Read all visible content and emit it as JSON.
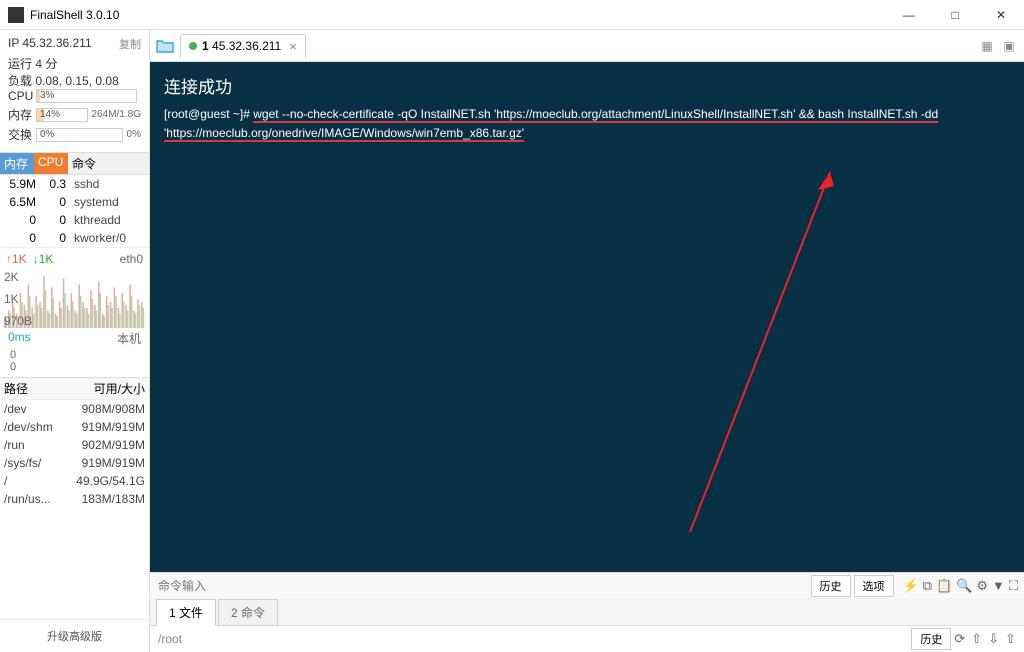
{
  "app": {
    "title": "FinalShell 3.0.10"
  },
  "win": {
    "min": "—",
    "max": "□",
    "close": "✕"
  },
  "sidebar": {
    "ip": "IP 45.32.36.211",
    "copy": "复制",
    "uptime": "运行 4 分",
    "load": "负载 0.08, 0.15, 0.08",
    "cpu": {
      "label": "CPU",
      "pct": "3%",
      "fill": 3
    },
    "mem": {
      "label": "内存",
      "pct": "14%",
      "extra": "264M/1.8G",
      "fill": 14
    },
    "swap": {
      "label": "交换",
      "pct": "0%",
      "extra": "0%",
      "fill": 0
    },
    "proc_hdr": {
      "c1": "内存",
      "c2": "CPU",
      "c3": "命令"
    },
    "procs": [
      {
        "mem": "5.9M",
        "cpu": "0.3",
        "cmd": "sshd"
      },
      {
        "mem": "6.5M",
        "cpu": "0",
        "cmd": "systemd"
      },
      {
        "mem": "0",
        "cpu": "0",
        "cmd": "kthreadd"
      },
      {
        "mem": "0",
        "cpu": "0",
        "cmd": "kworker/0"
      }
    ],
    "net": {
      "up": "↑1K",
      "dn": "↓1K",
      "iface": "eth0"
    },
    "chart_y": [
      "2K",
      "1K",
      "970B"
    ],
    "ping": {
      "ms": "0ms",
      "host": "本机"
    },
    "zeros": [
      "0",
      "0"
    ],
    "disk_hdr": {
      "c1": "路径",
      "c2": "可用/大小"
    },
    "disks": [
      {
        "path": "/dev",
        "size": "908M/908M"
      },
      {
        "path": "/dev/shm",
        "size": "919M/919M"
      },
      {
        "path": "/run",
        "size": "902M/919M"
      },
      {
        "path": "/sys/fs/",
        "size": "919M/919M"
      },
      {
        "path": "/",
        "size": "49.9G/54.1G"
      },
      {
        "path": "/run/us...",
        "size": "183M/183M"
      }
    ],
    "upgrade": "升级高级版"
  },
  "tab": {
    "num": "1",
    "title": "45.32.36.211",
    "close": "×"
  },
  "terminal": {
    "connected": "连接成功",
    "prompt": "[root@guest ~]# ",
    "cmd": "wget --no-check-certificate -qO InstallNET.sh 'https://moeclub.org/attachment/LinuxShell/InstallNET.sh' && bash InstallNET.sh -dd 'https://moeclub.org/onedrive/IMAGE/Windows/win7emb_x86.tar.gz'"
  },
  "cmdbar": {
    "placeholder": "命令输入",
    "history": "历史",
    "options": "选项"
  },
  "lowtabs": {
    "t1": "1 文件",
    "t2": "2 命令"
  },
  "pathbar": {
    "path": "/root",
    "history": "历史"
  },
  "chart_data": {
    "type": "bar",
    "series": [
      {
        "name": "up",
        "color": "#d88",
        "values": [
          400,
          600,
          900,
          500,
          1200,
          800,
          1500,
          700,
          1100,
          900,
          1800,
          600,
          1400,
          500,
          900,
          1700,
          800,
          1200,
          600,
          1500,
          900,
          700,
          1300,
          800,
          1600,
          500,
          1100,
          900,
          1400,
          700,
          1200,
          800,
          1500,
          600,
          1000,
          900
        ]
      },
      {
        "name": "dn",
        "color": "#8c8",
        "values": [
          300,
          500,
          700,
          400,
          900,
          600,
          1100,
          500,
          800,
          700,
          1300,
          500,
          1000,
          400,
          700,
          1200,
          600,
          900,
          500,
          1100,
          700,
          500,
          1000,
          600,
          1200,
          400,
          800,
          700,
          1100,
          500,
          900,
          600,
          1100,
          500,
          800,
          700
        ]
      }
    ],
    "ymax": 2000,
    "ylabels": [
      "2K",
      "1K",
      "970B"
    ]
  }
}
